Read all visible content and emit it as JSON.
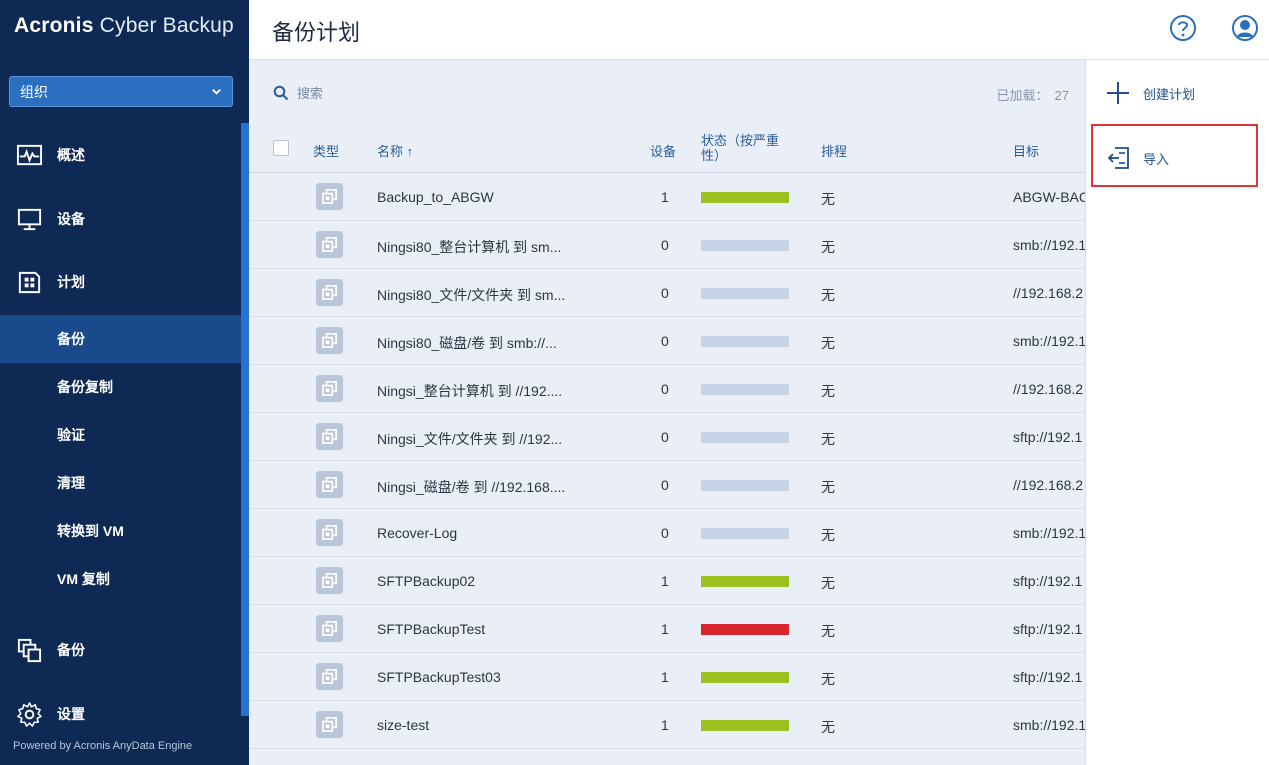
{
  "brand": {
    "name_bold": "Acronis",
    "name_light": " Cyber Backup"
  },
  "org_selector": {
    "value": "组织"
  },
  "sidebar": {
    "main_items": [
      {
        "label": "概述",
        "icon": "monitor-pulse-icon"
      },
      {
        "label": "设备",
        "icon": "computer-icon"
      },
      {
        "label": "计划",
        "icon": "plan-icon"
      }
    ],
    "sub_items": [
      {
        "label": "备份",
        "active": true
      },
      {
        "label": "备份复制"
      },
      {
        "label": "验证"
      },
      {
        "label": "清理"
      },
      {
        "label": "转换到 VM"
      },
      {
        "label": "VM 复制"
      }
    ],
    "bottom_items": [
      {
        "label": "备份",
        "icon": "backups-icon"
      },
      {
        "label": "设置",
        "icon": "gear-icon"
      }
    ],
    "powered_by": "Powered by Acronis AnyData Engine"
  },
  "header": {
    "title": "备份计划"
  },
  "search": {
    "placeholder": "搜索"
  },
  "loaded": {
    "label": "已加载：",
    "count": "27"
  },
  "table": {
    "columns": {
      "type": "类型",
      "name": "名称 ↑",
      "devices": "设备",
      "status": "状态（按严重性）",
      "schedule": "排程",
      "target": "目标"
    },
    "rows": [
      {
        "name": "Backup_to_ABGW",
        "devices": "1",
        "status": "ok",
        "schedule": "无",
        "target": "ABGW-BAC"
      },
      {
        "name": "Ningsi80_整台计算机 到 sm...",
        "devices": "0",
        "status": "none",
        "schedule": "无",
        "target": "smb://192.1"
      },
      {
        "name": "Ningsi80_文件/文件夹 到 sm...",
        "devices": "0",
        "status": "none",
        "schedule": "无",
        "target": "//192.168.2"
      },
      {
        "name": "Ningsi80_磁盘/卷 到 smb://...",
        "devices": "0",
        "status": "none",
        "schedule": "无",
        "target": "smb://192.1"
      },
      {
        "name": "Ningsi_整台计算机 到 //192....",
        "devices": "0",
        "status": "none",
        "schedule": "无",
        "target": "//192.168.2"
      },
      {
        "name": "Ningsi_文件/文件夹 到 //192...",
        "devices": "0",
        "status": "none",
        "schedule": "无",
        "target": "sftp://192.1"
      },
      {
        "name": "Ningsi_磁盘/卷 到 //192.168....",
        "devices": "0",
        "status": "none",
        "schedule": "无",
        "target": "//192.168.2"
      },
      {
        "name": "Recover-Log",
        "devices": "0",
        "status": "none",
        "schedule": "无",
        "target": "smb://192.1"
      },
      {
        "name": "SFTPBackup02",
        "devices": "1",
        "status": "ok",
        "schedule": "无",
        "target": "sftp://192.1"
      },
      {
        "name": "SFTPBackupTest",
        "devices": "1",
        "status": "error",
        "schedule": "无",
        "target": "sftp://192.1"
      },
      {
        "name": "SFTPBackupTest03",
        "devices": "1",
        "status": "ok",
        "schedule": "无",
        "target": "sftp://192.1"
      },
      {
        "name": "size-test",
        "devices": "1",
        "status": "ok",
        "schedule": "无",
        "target": "smb://192.1"
      }
    ]
  },
  "status_colors": {
    "ok": "#9bc120",
    "error": "#d9262e",
    "none": "#c6d3e6"
  },
  "actions": {
    "create": "创建计划",
    "import": "导入"
  }
}
